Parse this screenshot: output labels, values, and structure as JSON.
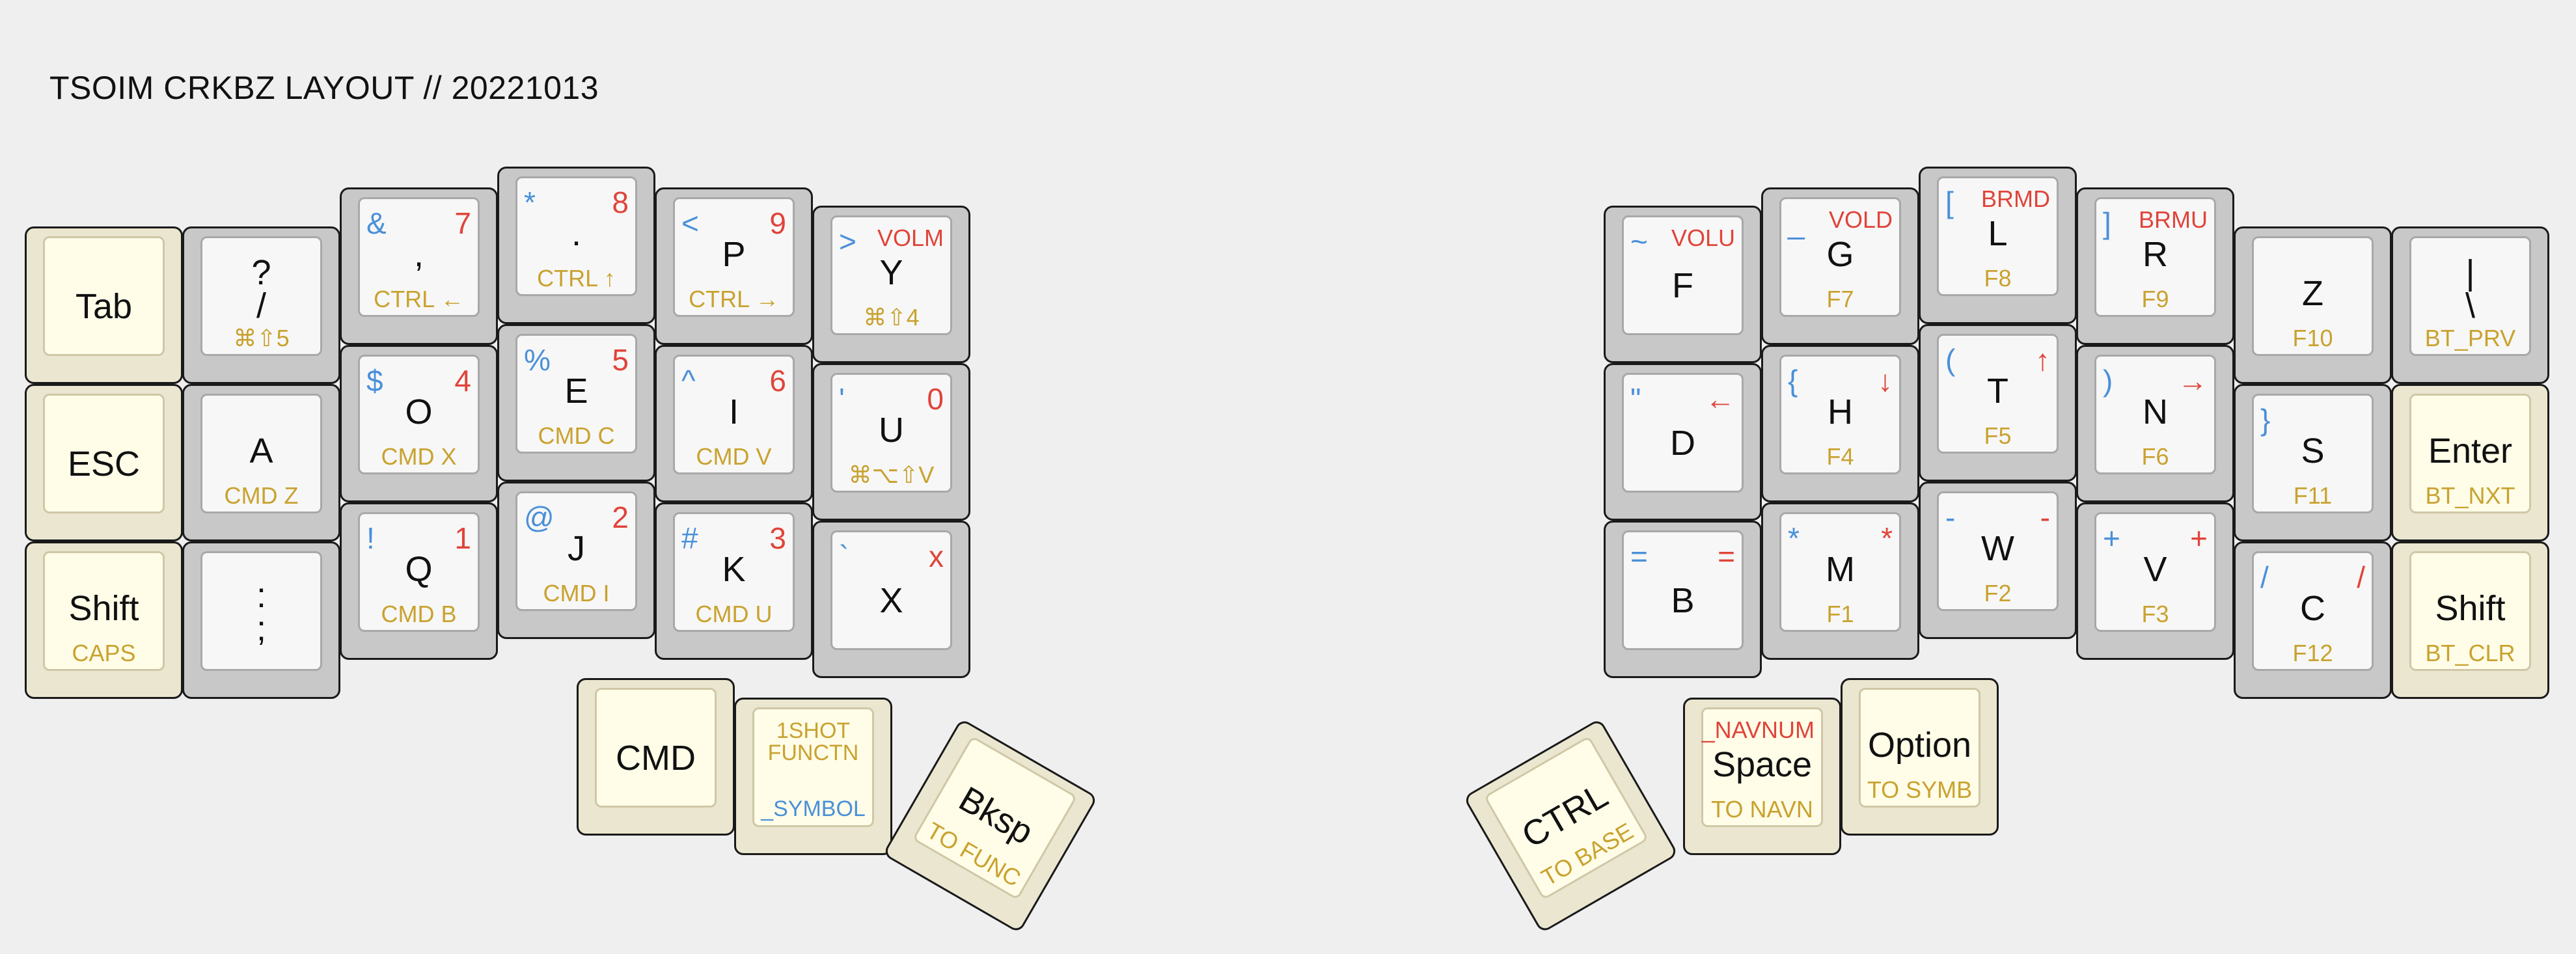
{
  "title": "TSOIM CRKBZ LAYOUT // 20221013",
  "colors": {
    "background": "#efefef",
    "key_alpha": "#c8c8c8",
    "key_mod": "#ebe6d0",
    "symbol_blue": "#4a90d9",
    "number_red": "#e0443a",
    "function_gold": "#c9a22f"
  },
  "left": {
    "tab": {
      "main": "Tab"
    },
    "esc": {
      "main": "ESC"
    },
    "shift": {
      "main": "Shift",
      "sub": "CAPS"
    },
    "question": {
      "main": "?\n/",
      "sub": "⌘⇧5"
    },
    "a": {
      "main": "A",
      "sub": "CMD Z"
    },
    "colon": {
      "main": ":\n;"
    },
    "comma": {
      "main": ",",
      "sub": "CTRL ←",
      "tl": "&",
      "tr": "7"
    },
    "o": {
      "main": "O",
      "sub": "CMD X",
      "tl": "$",
      "tr": "4"
    },
    "q": {
      "main": "Q",
      "sub": "CMD B",
      "tl": "!",
      "tr": "1"
    },
    "period": {
      "main": ".",
      "sub": "CTRL ↑",
      "tl": "*",
      "tr": "8"
    },
    "e": {
      "main": "E",
      "sub": "CMD C",
      "tl": "%",
      "tr": "5"
    },
    "j": {
      "main": "J",
      "sub": "CMD I",
      "tl": "@",
      "tr": "2"
    },
    "p": {
      "main": "P",
      "sub": "CTRL →",
      "tl": "<",
      "tr": "9"
    },
    "i": {
      "main": "I",
      "sub": "CMD V",
      "tl": "^",
      "tr": "6"
    },
    "k": {
      "main": "K",
      "sub": "CMD U",
      "tl": "#",
      "tr": "3"
    },
    "y": {
      "main": "Y",
      "sub": "⌘⇧4",
      "tl": ">",
      "tr": "VOLM"
    },
    "u": {
      "main": "U",
      "sub": "⌘⌥⇧V",
      "tl": "'",
      "tr": "0"
    },
    "x": {
      "main": "X",
      "tl": "`",
      "tr": "x"
    },
    "cmd": {
      "main": "CMD"
    },
    "oneshot": {
      "top": "1SHOT\nFUNCTN",
      "bottom": "_SYMBOL"
    },
    "bksp": {
      "main": "Bksp",
      "sub": "TO FUNC"
    }
  },
  "right": {
    "f": {
      "main": "F",
      "tl": "~",
      "tr": "VOLU"
    },
    "d": {
      "main": "D",
      "tl": "\"",
      "tr": "←"
    },
    "b": {
      "main": "B",
      "tl": "=",
      "tr": "="
    },
    "g": {
      "main": "G",
      "sub": "F7",
      "tl": "_",
      "tr": "VOLD"
    },
    "h": {
      "main": "H",
      "sub": "F4",
      "tl": "{",
      "tr": "↓"
    },
    "m": {
      "main": "M",
      "sub": "F1",
      "tl": "*",
      "tr": "*"
    },
    "l": {
      "main": "L",
      "sub": "F8",
      "tl": "[",
      "tr": "BRMD"
    },
    "t": {
      "main": "T",
      "sub": "F5",
      "tl": "(",
      "tr": "↑"
    },
    "w": {
      "main": "W",
      "sub": "F2",
      "tl": "-",
      "tr": "-"
    },
    "r": {
      "main": "R",
      "sub": "F9",
      "tl": "]",
      "tr": "BRMU"
    },
    "n": {
      "main": "N",
      "sub": "F6",
      "tl": ")",
      "tr": "→"
    },
    "v": {
      "main": "V",
      "sub": "F3",
      "tl": "+",
      "tr": "+"
    },
    "z": {
      "main": "Z",
      "sub": "F10"
    },
    "s": {
      "main": "S",
      "sub": "F11",
      "tl": "}"
    },
    "c": {
      "main": "C",
      "sub": "F12",
      "tl": "/",
      "tr": "/"
    },
    "pipe": {
      "main": "|\n\\",
      "sub": "BT_PRV"
    },
    "enter": {
      "main": "Enter",
      "sub": "BT_NXT"
    },
    "shift": {
      "main": "Shift",
      "sub": "BT_CLR"
    },
    "ctrl": {
      "main": "CTRL",
      "sub": "TO BASE"
    },
    "space": {
      "main": "Space",
      "sub": "TO NAVN",
      "tr": "_NAVNUM"
    },
    "option": {
      "main": "Option",
      "sub": "TO SYMB"
    }
  }
}
